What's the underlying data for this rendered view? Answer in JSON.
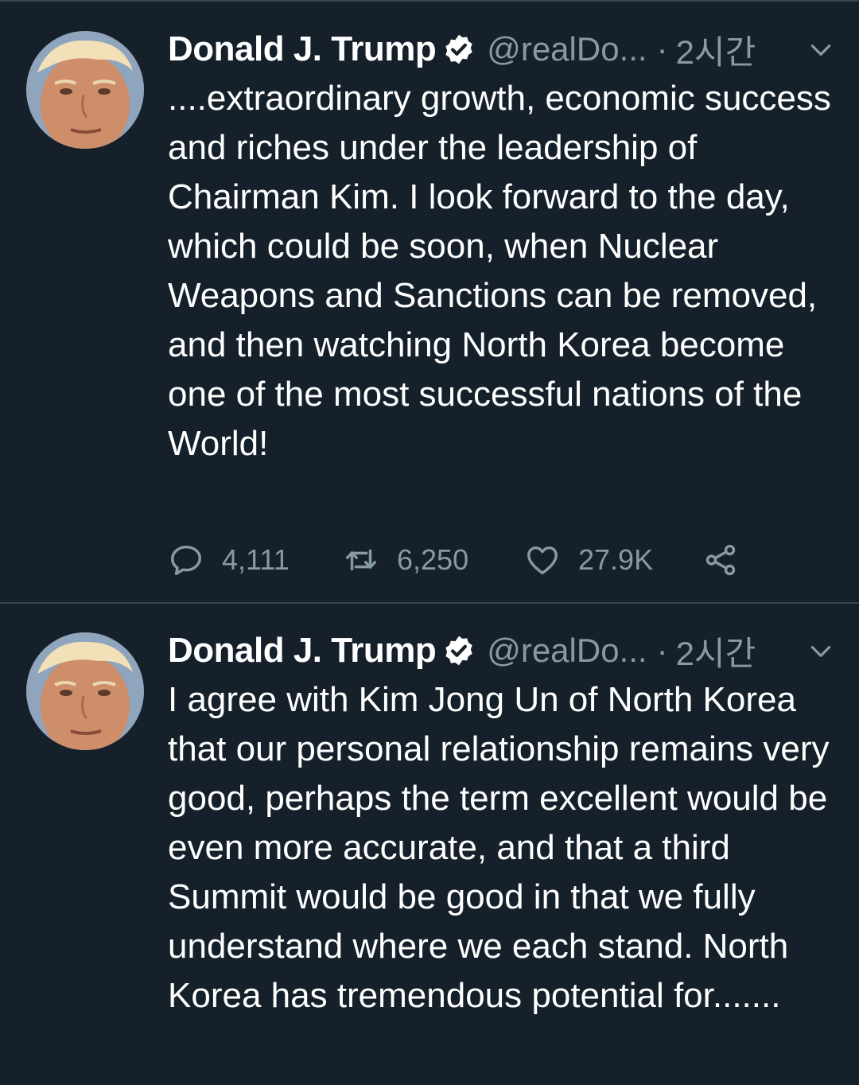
{
  "tweets": [
    {
      "author_name": "Donald J. Trump",
      "handle": "@realDo...",
      "separator": "·",
      "time": "2시간",
      "text": "....extraordinary growth, economic success and riches under the leadership of Chairman Kim. I look forward to the day, which could be soon, when Nuclear Weapons and Sanctions can be removed, and then watching North Korea become one of the most successful nations of the World!",
      "stats": {
        "replies": "4,111",
        "retweets": "6,250",
        "likes": "27.9K"
      }
    },
    {
      "author_name": "Donald J. Trump",
      "handle": "@realDo...",
      "separator": "·",
      "time": "2시간",
      "text": "I agree with Kim Jong Un of North Korea that our personal relationship remains very good, perhaps the term excellent would be even more accurate, and that a third Summit would be good in that we fully understand where we each stand. North Korea has tremendous potential for......."
    }
  ],
  "icons": {
    "verified": "verified-badge-icon",
    "caret": "chevron-down-icon",
    "reply": "reply-icon",
    "retweet": "retweet-icon",
    "like": "heart-icon",
    "share": "share-icon"
  },
  "colors": {
    "background": "#15202b",
    "text": "#ffffff",
    "secondary": "#8899a6",
    "divider": "#38444d"
  }
}
